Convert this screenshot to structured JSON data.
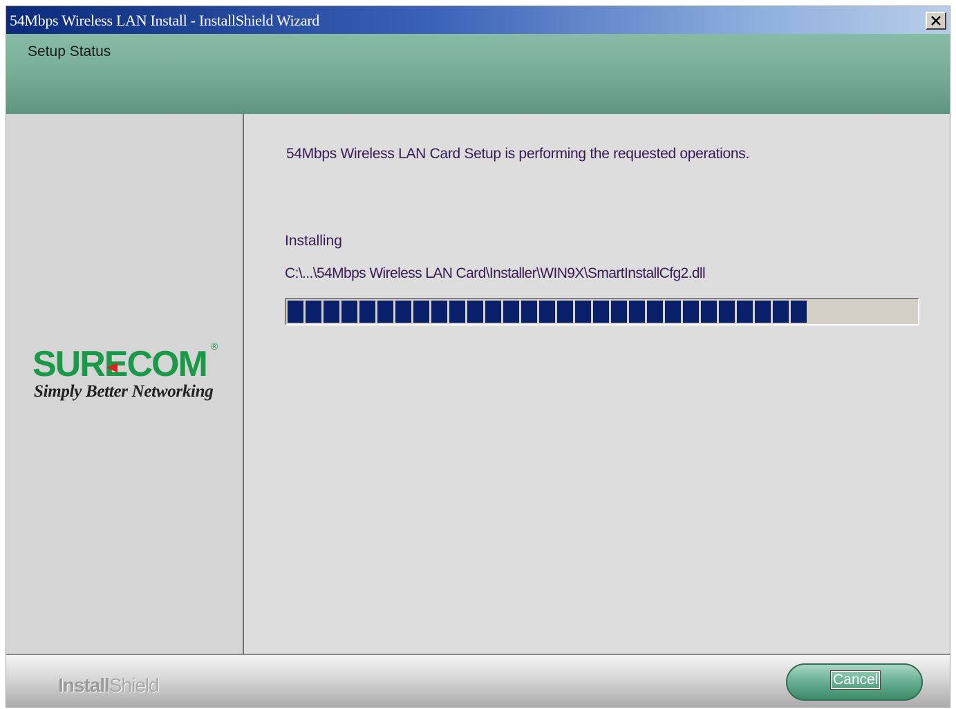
{
  "window": {
    "title": "54Mbps Wireless LAN Install - InstallShield Wizard"
  },
  "header": {
    "title": "Setup Status"
  },
  "branding": {
    "logo_word": "SURECOM",
    "logo_registered": "®",
    "tagline": "Simply Better Networking",
    "footer_brand_bold": "Install",
    "footer_brand_light": "Shield"
  },
  "main": {
    "message": "54Mbps Wireless LAN Card Setup is performing the requested operations.",
    "status_label": "Installing",
    "file_path": "C:\\...\\54Mbps Wireless LAN Card\\Installer\\WIN9X\\SmartInstallCfg2.dll",
    "progress_percent": 81
  },
  "footer": {
    "cancel_label": "Cancel"
  },
  "colors": {
    "title_bar_start": "#0b2a7a",
    "header_band": "#78ad98",
    "progress_block": "#0a1f6a",
    "logo_green": "#1a9a48",
    "logo_arrow": "#e02020",
    "text": "#3a1a55"
  },
  "icons": {
    "close": "close-icon",
    "logo_arrow": "arrow-left-icon"
  }
}
